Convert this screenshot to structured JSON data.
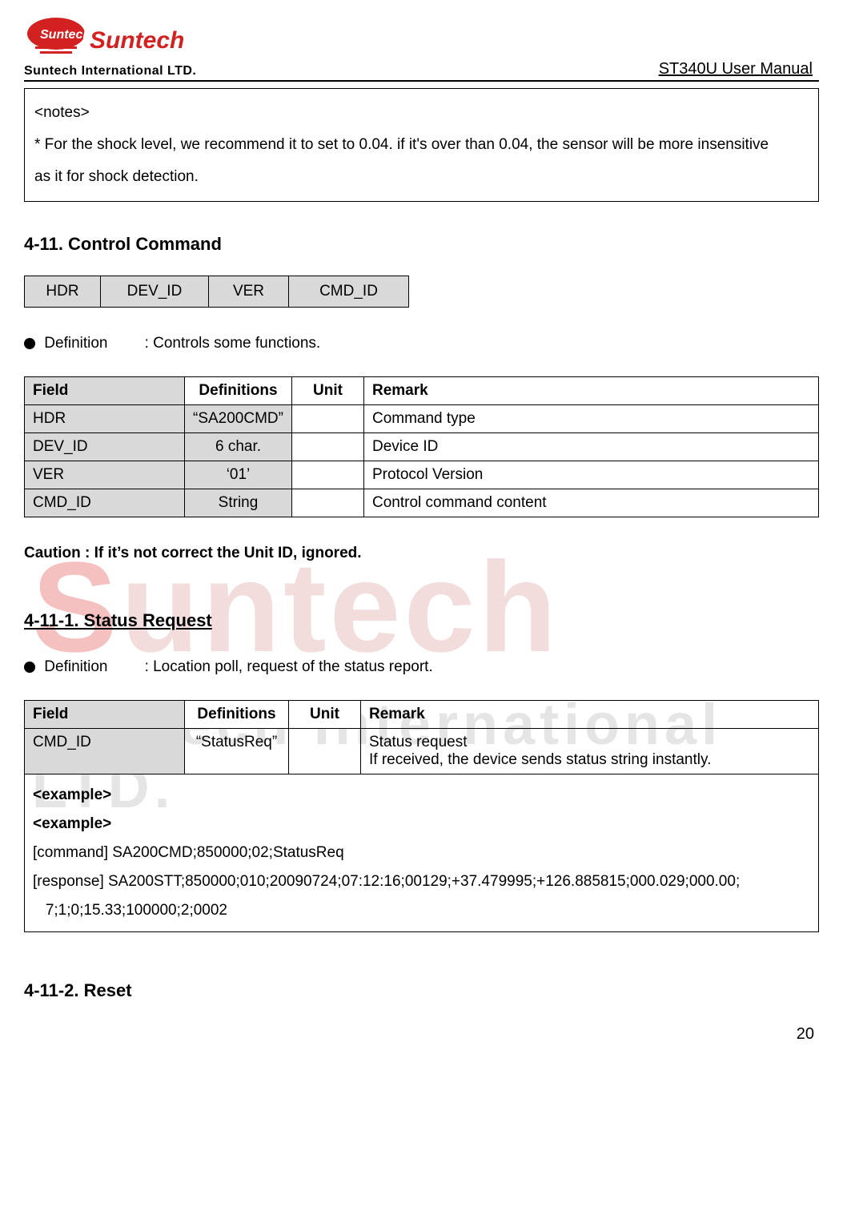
{
  "header": {
    "logo_text": "Suntech",
    "logo_sub": "Suntech International LTD.",
    "doc_title": "ST340U User Manual"
  },
  "notes": {
    "title": "<notes>",
    "line1": "* For the shock level, we recommend it to set to 0.04. if it's over  than 0.04, the sensor will be more insensitive",
    "line2": "as it for shock detection."
  },
  "sec_411": {
    "title": "4-11. Control Command",
    "row": [
      "HDR",
      "DEV_ID",
      "VER",
      "CMD_ID"
    ],
    "def_label": "Definition",
    "def_text": ": Controls some functions.",
    "table": {
      "headers": [
        "Field",
        "Definitions",
        "Unit",
        "Remark"
      ],
      "rows": [
        {
          "field": "HDR",
          "def": "“SA200CMD”",
          "unit": "",
          "remark": "Command type"
        },
        {
          "field": "DEV_ID",
          "def": "6 char.",
          "unit": "",
          "remark": "Device ID"
        },
        {
          "field": "VER",
          "def": "‘01’",
          "unit": "",
          "remark": "Protocol Version"
        },
        {
          "field": "CMD_ID",
          "def": "String",
          "unit": "",
          "remark": "Control command content"
        }
      ]
    },
    "caution": "Caution : If it’s not correct the Unit ID, ignored."
  },
  "sec_4111": {
    "title": "4-11-1. Status Request",
    "def_label": "Definition",
    "def_text": ": Location poll, request of the status report.",
    "table": {
      "headers": [
        "Field",
        "Definitions",
        "Unit",
        "Remark"
      ],
      "row": {
        "field": "CMD_ID",
        "def": "“StatusReq”",
        "unit": "",
        "remark_l1": "Status request",
        "remark_l2": "If received, the device sends status string instantly."
      },
      "example": {
        "l1": "<example>",
        "l2": "<example>",
        "l3": "[command] SA200CMD;850000;02;StatusReq",
        "l4": "[response] SA200STT;850000;010;20090724;07:12:16;00129;+37.479995;+126.885815;000.029;000.00;",
        "l5": "   7;1;0;15.33;100000;2;0002"
      }
    }
  },
  "sec_4112": {
    "title": "4-11-2. Reset"
  },
  "page_number": "20",
  "watermark": {
    "line1a": "S",
    "line1b": "untech",
    "line2": "Suntech International LTD."
  }
}
